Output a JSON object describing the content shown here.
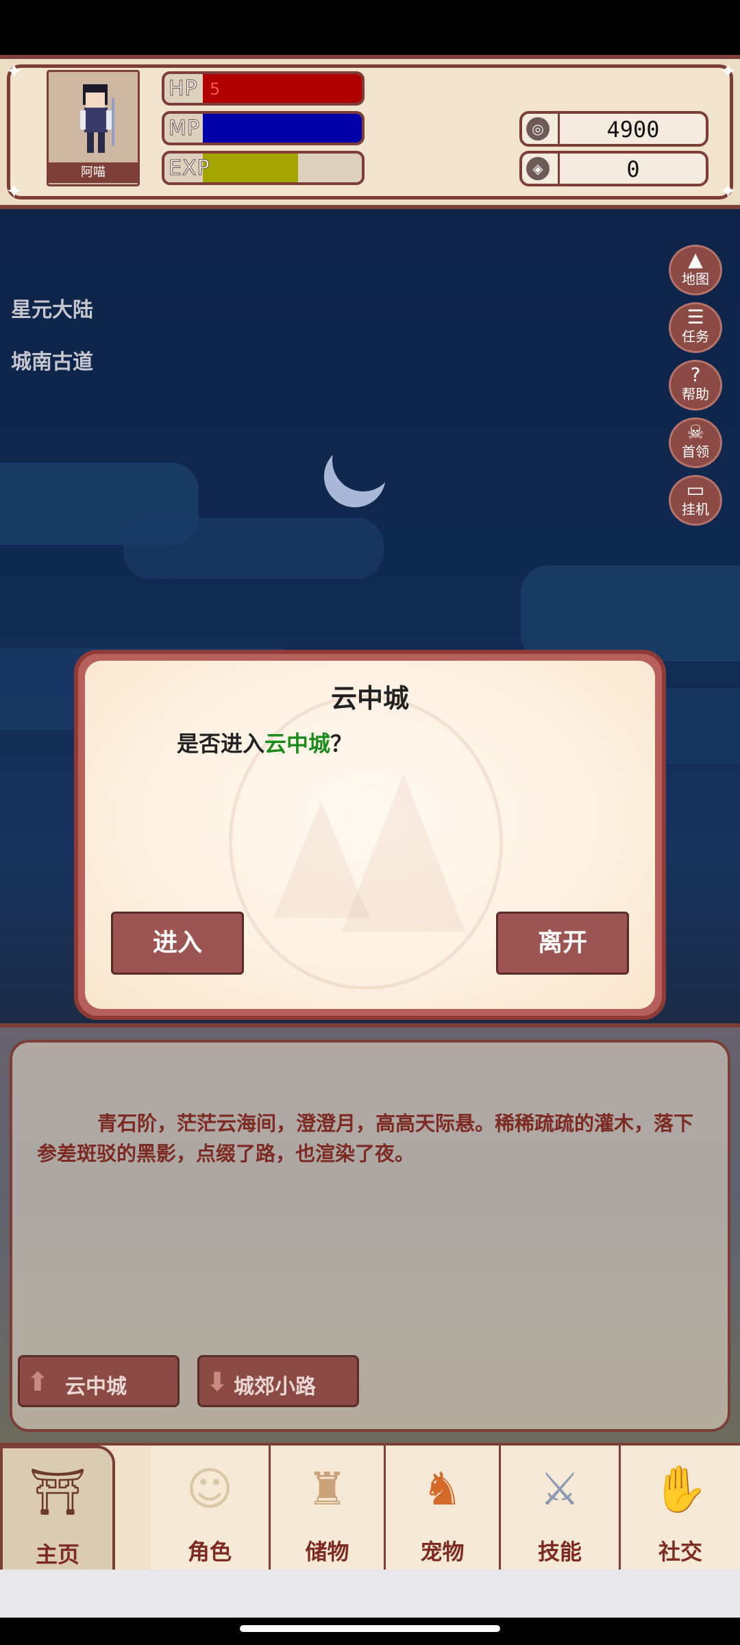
{
  "player": {
    "name": "阿喵",
    "hp_label": "HP",
    "hp_value": "5",
    "hp_fraction": 1.0,
    "mp_label": "MP",
    "mp_fraction": 1.0,
    "exp_label": "EXP",
    "exp_fraction": 0.6
  },
  "currency": {
    "coins": "4900",
    "gems": "0"
  },
  "location": {
    "region": "星元大陆",
    "area": "城南古道"
  },
  "side_menu": [
    {
      "icon": "mountain-icon",
      "label": "地图"
    },
    {
      "icon": "scroll-icon",
      "label": "任务"
    },
    {
      "icon": "question-icon",
      "label": "帮助"
    },
    {
      "icon": "skull-icon",
      "label": "首领"
    },
    {
      "icon": "monitor-icon",
      "label": "挂机"
    }
  ],
  "dialog": {
    "title": "云中城",
    "prompt_prefix": "是否进入",
    "prompt_highlight": "云中城",
    "prompt_suffix": "？",
    "enter_label": "进入",
    "leave_label": "离开"
  },
  "story": {
    "text": "青石阶，茫茫云海间，澄澄月，高高天际悬。稀稀疏疏的灌木，落下参差斑驳的黑影，点缀了路，也渲染了夜。"
  },
  "paths": {
    "up_label": "云中城",
    "down_label": "城郊小路"
  },
  "nav": {
    "home": "主页",
    "character": "角色",
    "storage": "储物",
    "pet": "宠物",
    "skills": "技能",
    "social": "社交"
  },
  "colors": {
    "frame": "#7c3e36",
    "hp": "#b00000",
    "mp": "#0000a8",
    "exp": "#a5a500",
    "highlight": "#1b8c1b"
  }
}
